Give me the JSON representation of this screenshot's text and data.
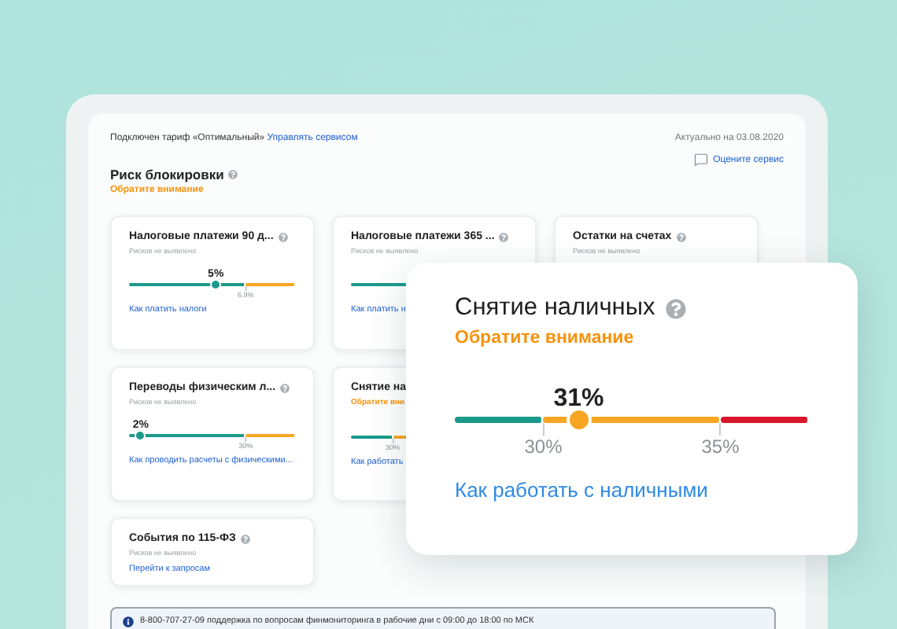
{
  "header": {
    "tariff": "Подключен тариф «Оптимальный»",
    "manage_link": "Управлять сервисом",
    "updated": "Актуально на 03.08.2020",
    "rate_link": "Оцените сервис"
  },
  "section": {
    "title": "Риск блокировки",
    "status": "Обратите внимание"
  },
  "cards": [
    {
      "title": "Налоговые платежи 90 д...",
      "subtitle": "Рисков не выявлено",
      "alert": false,
      "meter": {
        "kind": "dual",
        "value": "5%",
        "level": 0.52,
        "segments": [
          {
            "color": "#1a9a8a"
          },
          {
            "color": "#f6a623",
            "tick": "6.9%"
          }
        ]
      },
      "link": "Как платить налоги"
    },
    {
      "title": "Налоговые платежи 365 ...",
      "subtitle": "Рисков не выявлено",
      "alert": false,
      "meter": {
        "kind": "dual",
        "segments": [
          {
            "color": "#1a9a8a"
          }
        ]
      },
      "link": "Как платить н"
    },
    {
      "title": "Остатки на счетах",
      "subtitle": "Рисков не выявлено",
      "alert": false
    },
    {
      "title": "Переводы физическим л...",
      "subtitle": "Рисков не выявлено",
      "alert": false,
      "meter": {
        "kind": "dual",
        "value": "2%",
        "level": 0.07,
        "segments": [
          {
            "color": "#1a9a8a"
          },
          {
            "color": "#f6a623",
            "tick": "30%"
          }
        ]
      },
      "link": "Как проводить расчеты с физическими..."
    },
    {
      "title": "Снятие на",
      "subtitle": "Обратите вни",
      "alert": true,
      "meter": {
        "kind": "triple",
        "segments": [
          {
            "color": "#1a9a8a"
          },
          {
            "color": "#f6a623",
            "tick": "30%"
          }
        ]
      },
      "link": "Как работать"
    },
    {
      "title": "События по 115-ФЗ",
      "subtitle": "Рисков не выявлено",
      "alert": false,
      "link": "Перейти к запросам"
    }
  ],
  "popup": {
    "title": "Снятие наличных",
    "subtitle": "Обратите внимание",
    "alert": true,
    "meter": {
      "kind": "triple",
      "value": "31%",
      "level": 0.35,
      "segments": [
        {
          "color": "#1a9a8a"
        },
        {
          "color": "#f6a623",
          "tick": "30%"
        },
        {
          "color": "#d9172c",
          "tick": "35%"
        }
      ]
    },
    "link": "Как работать с наличными"
  },
  "support": {
    "text": "8-800-707-27-09 поддержка по вопросам финмониторинга в рабочие дни с 09:00 до 18:00 по МСК"
  }
}
